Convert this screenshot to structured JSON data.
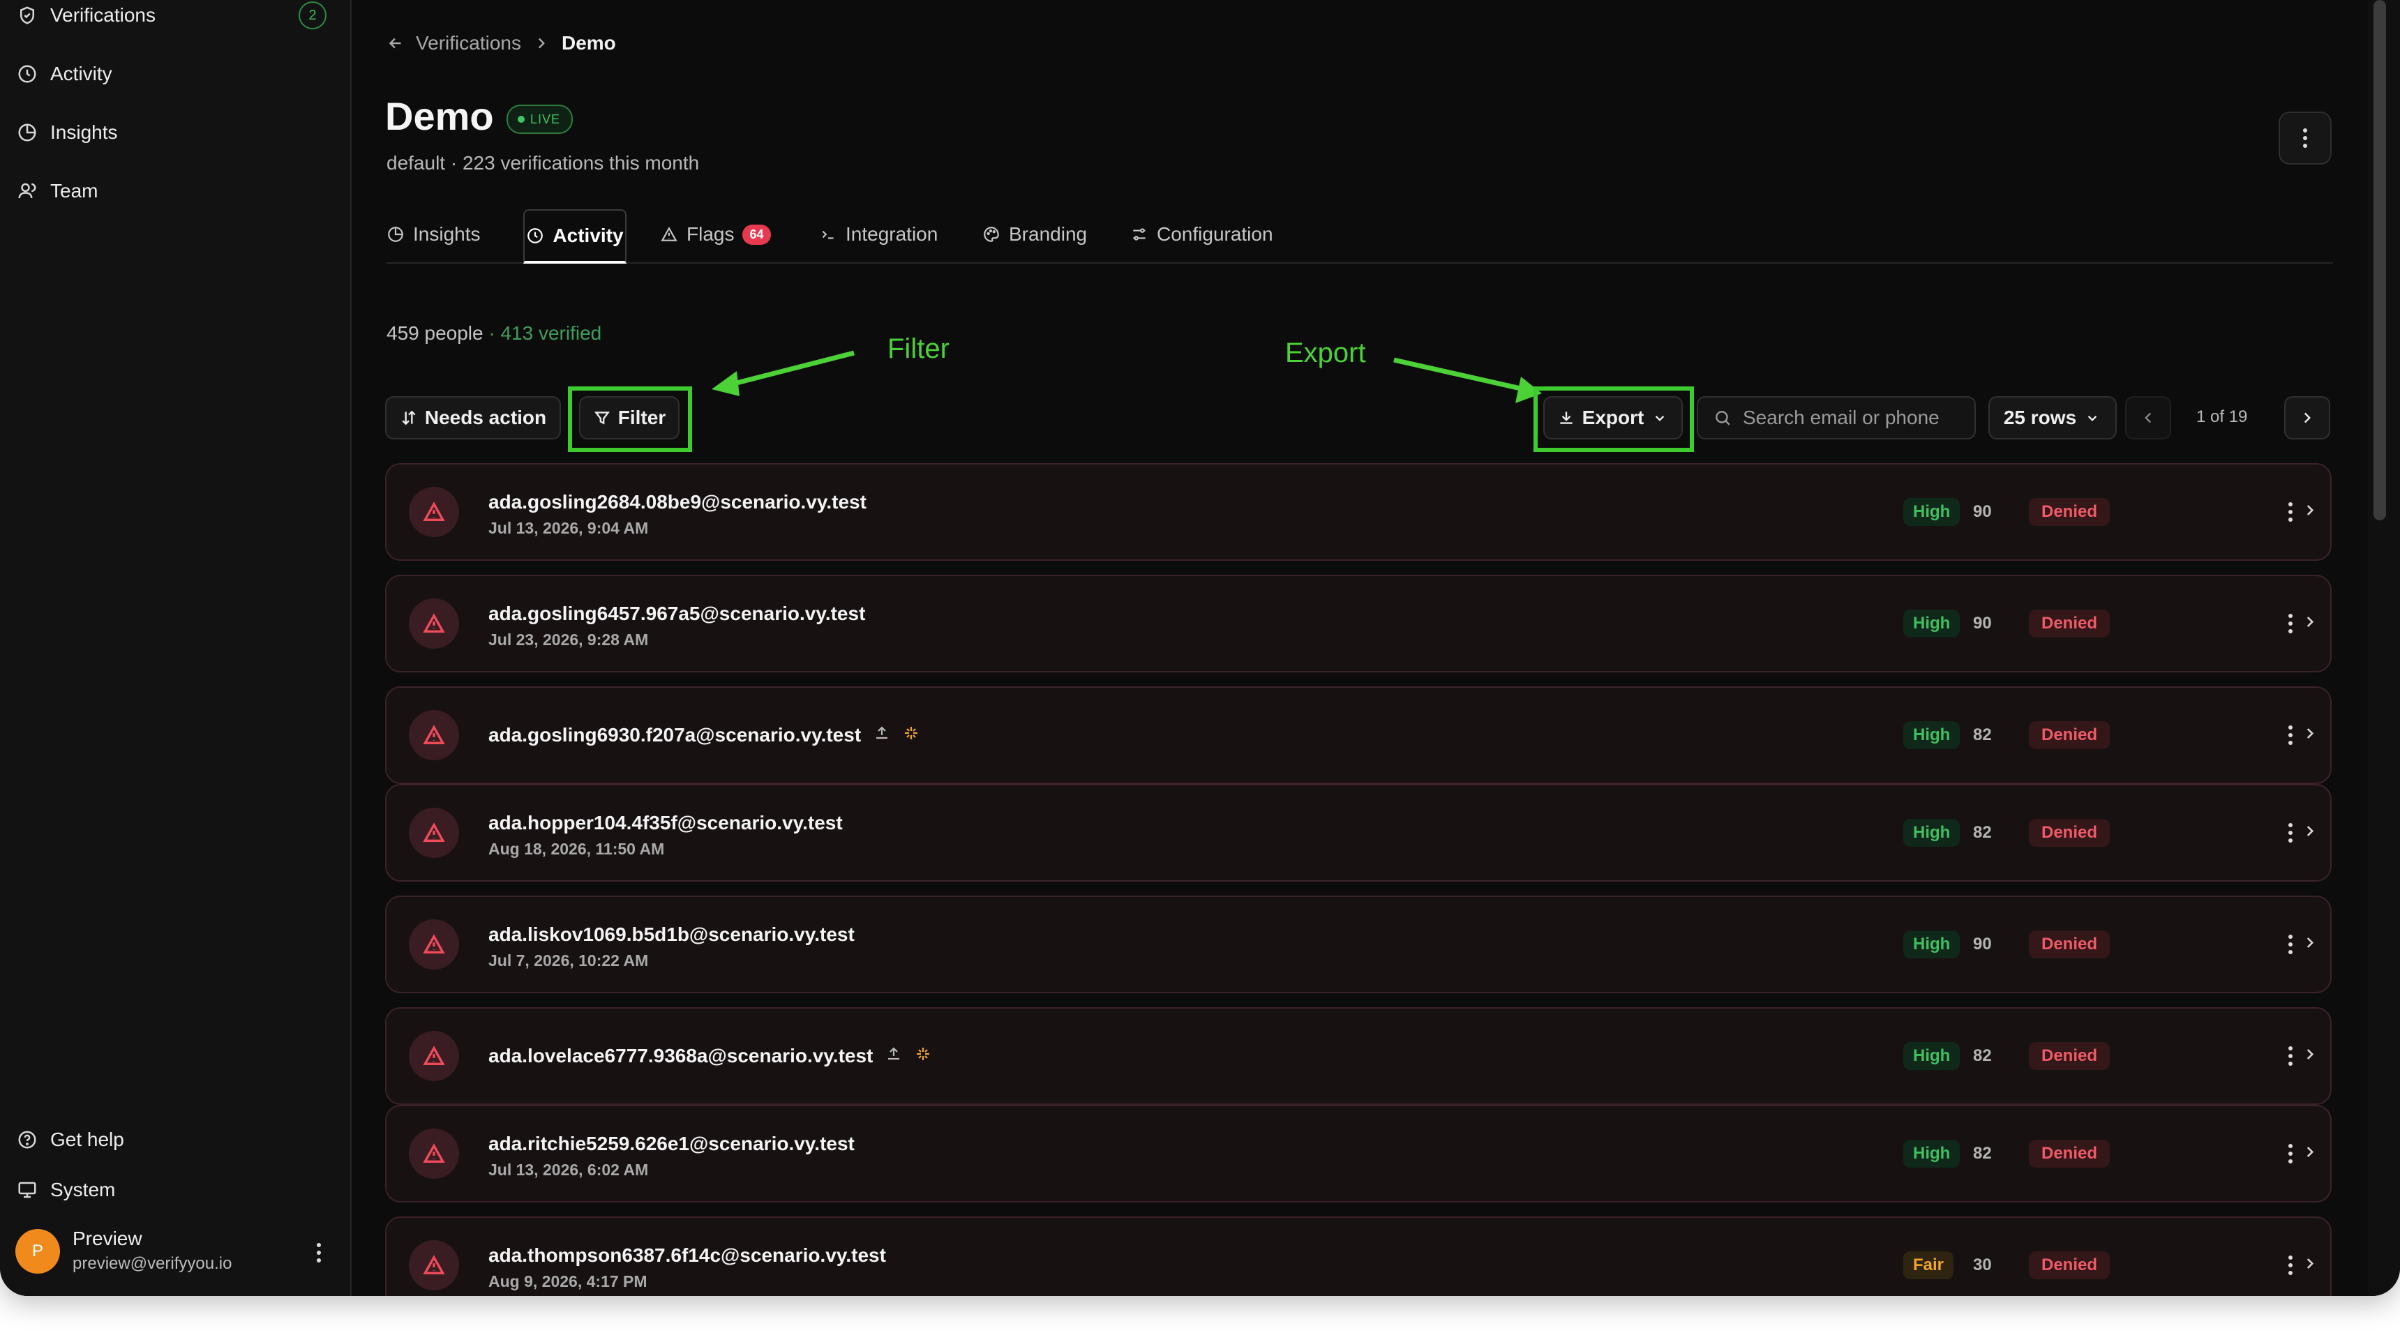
{
  "sidebar": {
    "items": [
      {
        "label": "Verifications",
        "icon": "shield-check-icon",
        "badge": "2"
      },
      {
        "label": "Activity",
        "icon": "clock-icon"
      },
      {
        "label": "Insights",
        "icon": "pie-chart-icon"
      },
      {
        "label": "Team",
        "icon": "users-icon"
      }
    ],
    "footer_items": [
      {
        "label": "Get help",
        "icon": "help-circle-icon"
      },
      {
        "label": "System",
        "icon": "monitor-icon"
      }
    ],
    "user": {
      "initial": "P",
      "name": "Preview",
      "email": "preview@verifyyou.io"
    }
  },
  "breadcrumb": {
    "parent": "Verifications",
    "current": "Demo"
  },
  "header": {
    "title": "Demo",
    "live_badge": "LIVE",
    "subtitle": "default · 223 verifications this month"
  },
  "tabs": [
    {
      "label": "Insights",
      "icon": "pie-chart-icon"
    },
    {
      "label": "Activity",
      "icon": "clock-icon",
      "active": true
    },
    {
      "label": "Flags",
      "icon": "warning-triangle-icon",
      "count": "64"
    },
    {
      "label": "Integration",
      "icon": "terminal-icon"
    },
    {
      "label": "Branding",
      "icon": "palette-icon"
    },
    {
      "label": "Configuration",
      "icon": "sliders-icon"
    }
  ],
  "summary": {
    "people": "459 people",
    "separator": " · ",
    "verified": "413 verified"
  },
  "annotations": {
    "filter": "Filter",
    "export": "Export",
    "color": "#4cd137"
  },
  "toolbar": {
    "sort_label": "Needs action",
    "filter_label": "Filter",
    "export_label": "Export",
    "search_placeholder": "Search email or phone",
    "rows_label": "25 rows",
    "page_label": "1 of 19"
  },
  "rows": [
    {
      "email": "ada.gosling2684.08be9@scenario.vy.test",
      "date": "Jul 13, 2026, 9:04 AM",
      "risk": "High",
      "score": "90",
      "status": "Denied",
      "extra_icons": false
    },
    {
      "email": "ada.gosling6457.967a5@scenario.vy.test",
      "date": "Jul 23, 2026, 9:28 AM",
      "risk": "High",
      "score": "90",
      "status": "Denied",
      "extra_icons": false
    },
    {
      "email": "ada.gosling6930.f207a@scenario.vy.test",
      "date": "",
      "risk": "High",
      "score": "82",
      "status": "Denied",
      "extra_icons": true
    },
    {
      "email": "ada.hopper104.4f35f@scenario.vy.test",
      "date": "Aug 18, 2026, 11:50 AM",
      "risk": "High",
      "score": "82",
      "status": "Denied",
      "extra_icons": false
    },
    {
      "email": "ada.liskov1069.b5d1b@scenario.vy.test",
      "date": "Jul 7, 2026, 10:22 AM",
      "risk": "High",
      "score": "90",
      "status": "Denied",
      "extra_icons": false
    },
    {
      "email": "ada.lovelace6777.9368a@scenario.vy.test",
      "date": "",
      "risk": "High",
      "score": "82",
      "status": "Denied",
      "extra_icons": true
    },
    {
      "email": "ada.ritchie5259.626e1@scenario.vy.test",
      "date": "Jul 13, 2026, 6:02 AM",
      "risk": "High",
      "score": "82",
      "status": "Denied",
      "extra_icons": false
    },
    {
      "email": "ada.thompson6387.6f14c@scenario.vy.test",
      "date": "Aug 9, 2026, 4:17 PM",
      "risk": "Fair",
      "score": "30",
      "status": "Denied",
      "extra_icons": false
    }
  ],
  "colors": {
    "accent_green": "#3fc563",
    "denied_red": "#ef5a67",
    "fair_amber": "#f0a52a",
    "annotation_green": "#4cd137"
  }
}
